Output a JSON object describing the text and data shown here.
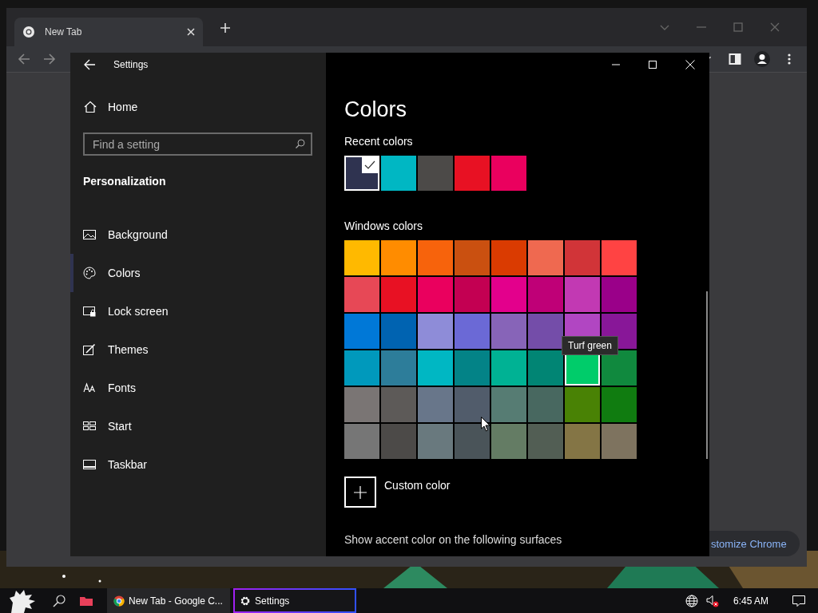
{
  "browser": {
    "tab": {
      "title": "New Tab",
      "selected": true
    },
    "customize_button": "stomize Chrome"
  },
  "settings": {
    "title": "Settings",
    "home": "Home",
    "search": {
      "placeholder": "Find a setting"
    },
    "section": "Personalization",
    "items": [
      {
        "label": "Background",
        "kind": "picture",
        "selected": false
      },
      {
        "label": "Colors",
        "kind": "palette",
        "selected": true
      },
      {
        "label": "Lock screen",
        "kind": "lock-screen",
        "selected": false
      },
      {
        "label": "Themes",
        "kind": "brush",
        "selected": false
      },
      {
        "label": "Fonts",
        "kind": "font",
        "selected": false
      },
      {
        "label": "Start",
        "kind": "tiles",
        "selected": false
      },
      {
        "label": "Taskbar",
        "kind": "taskbar",
        "selected": false
      }
    ],
    "page_title": "Colors",
    "recent_label": "Recent colors",
    "recent": [
      {
        "color": "#2f3350",
        "selected": true
      },
      {
        "color": "#00b7c3",
        "selected": false
      },
      {
        "color": "#4c4a48",
        "selected": false
      },
      {
        "color": "#e81123",
        "selected": false
      },
      {
        "color": "#ea005e",
        "selected": false
      }
    ],
    "windows_label": "Windows colors",
    "windows_colors": [
      {
        "color": "#ffb900",
        "selected": false
      },
      {
        "color": "#ff8c00",
        "selected": false
      },
      {
        "color": "#f7630c",
        "selected": false
      },
      {
        "color": "#ca5010",
        "selected": false
      },
      {
        "color": "#da3b01",
        "selected": false
      },
      {
        "color": "#ef6950",
        "selected": false
      },
      {
        "color": "#d13438",
        "selected": false
      },
      {
        "color": "#ff4343",
        "selected": false
      },
      {
        "color": "#e74856",
        "selected": false
      },
      {
        "color": "#e81123",
        "selected": false
      },
      {
        "color": "#ea005e",
        "selected": false
      },
      {
        "color": "#c30052",
        "selected": false
      },
      {
        "color": "#e3008c",
        "selected": false
      },
      {
        "color": "#bf0077",
        "selected": false
      },
      {
        "color": "#c239b3",
        "selected": false
      },
      {
        "color": "#9a0089",
        "selected": false
      },
      {
        "color": "#0078d7",
        "selected": false
      },
      {
        "color": "#0063b1",
        "selected": false
      },
      {
        "color": "#8e8cd8",
        "selected": false
      },
      {
        "color": "#6b69d6",
        "selected": false
      },
      {
        "color": "#8764b8",
        "selected": false
      },
      {
        "color": "#744da9",
        "selected": false
      },
      {
        "color": "#b146c2",
        "selected": false
      },
      {
        "color": "#881798",
        "selected": false
      },
      {
        "color": "#0099bc",
        "selected": false
      },
      {
        "color": "#2d7d9a",
        "selected": false
      },
      {
        "color": "#00b7c3",
        "selected": false
      },
      {
        "color": "#038387",
        "selected": false
      },
      {
        "color": "#00b294",
        "selected": false
      },
      {
        "color": "#018574",
        "selected": false
      },
      {
        "color": "#00cc6a",
        "selected": true
      },
      {
        "color": "#10893e",
        "selected": false
      },
      {
        "color": "#7a7574",
        "selected": false
      },
      {
        "color": "#5d5a58",
        "selected": false
      },
      {
        "color": "#68768a",
        "selected": false
      },
      {
        "color": "#515c6b",
        "selected": false
      },
      {
        "color": "#567c73",
        "selected": false
      },
      {
        "color": "#486860",
        "selected": false
      },
      {
        "color": "#498205",
        "selected": false
      },
      {
        "color": "#107c10",
        "selected": false
      },
      {
        "color": "#767676",
        "selected": false
      },
      {
        "color": "#4c4a48",
        "selected": false
      },
      {
        "color": "#69797e",
        "selected": false
      },
      {
        "color": "#4a5459",
        "selected": false
      },
      {
        "color": "#647c64",
        "selected": false
      },
      {
        "color": "#525e54",
        "selected": false
      },
      {
        "color": "#847545",
        "selected": false
      },
      {
        "color": "#7e735f",
        "selected": false
      }
    ],
    "tooltip": "Turf green",
    "custom_color": "Custom color",
    "accent_heading": "Show accent color on the following surfaces"
  },
  "taskbar": {
    "apps": [
      {
        "label": "New Tab - Google C...",
        "kind": "chrome",
        "selected": false
      },
      {
        "label": "Settings",
        "kind": "gear",
        "selected": true
      }
    ],
    "clock": "6:45 AM"
  }
}
